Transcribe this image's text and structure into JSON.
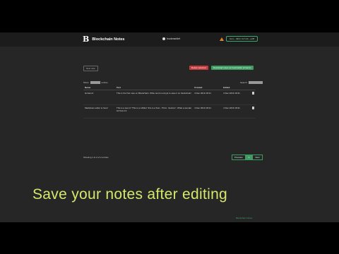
{
  "header": {
    "logo": "B",
    "app_name": "Blockchain Notes",
    "bookmarklet": "bookmarklet",
    "user_button": "0x1c...d9f3 | 0x7c1b...e2f8"
  },
  "toolbar": {
    "new_label": "New note",
    "delete_label": "Delete selected",
    "download_label": "Download notes as bookmarks (2 items)"
  },
  "table_controls": {
    "show_prefix": "Show",
    "show_suffix": "entries",
    "search_label": "Search:"
  },
  "table": {
    "columns": [
      "Name",
      "Text",
      "Created",
      "Edited",
      ""
    ],
    "rows": [
      {
        "name": "Hi Aaron!",
        "text": "This is the first note on Blockchain. Write text & encrypt to save it on blockchain!",
        "created": "4 Dec 2019 18:31",
        "edited": "4 Dec 2019 18:31"
      },
      {
        "name": "Markdown editor is here!",
        "text": "This is a test of \"This is a LIKELY this is a Test - Third - Section\". What a wonder ful Tool 2.0",
        "created": "4 Dec 2019 18:31",
        "edited": "4 Dec 2019 18:31"
      }
    ]
  },
  "pagination": {
    "showing": "Showing 1 to 2 of 2 entries",
    "previous": "Previous",
    "current": "1",
    "next": "Next"
  },
  "caption": "Save your notes after editing",
  "footer_link": "Blockchain Notes"
}
